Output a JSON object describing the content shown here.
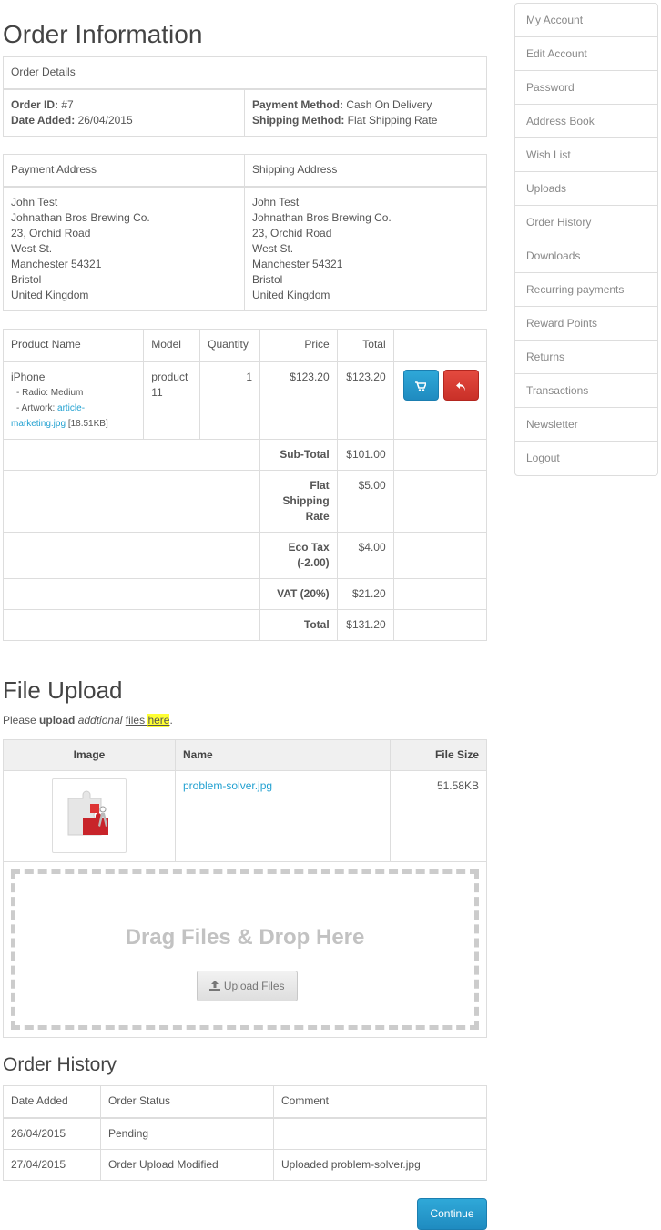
{
  "order_info": {
    "title": "Order Information",
    "details_header": "Order Details",
    "order_id_label": "Order ID:",
    "order_id_value": "#7",
    "date_added_label": "Date Added:",
    "date_added_value": "26/04/2015",
    "payment_method_label": "Payment Method:",
    "payment_method_value": "Cash On Delivery",
    "shipping_method_label": "Shipping Method:",
    "shipping_method_value": "Flat Shipping Rate"
  },
  "addresses": {
    "payment_header": "Payment Address",
    "shipping_header": "Shipping Address",
    "payment_lines": [
      "John Test",
      "Johnathan Bros Brewing Co.",
      "23, Orchid Road",
      "West St.",
      "Manchester 54321",
      "Bristol",
      "United Kingdom"
    ],
    "shipping_lines": [
      "John Test",
      "Johnathan Bros Brewing Co.",
      "23, Orchid Road",
      "West St.",
      "Manchester 54321",
      "Bristol",
      "United Kingdom"
    ]
  },
  "products": {
    "headers": [
      "Product Name",
      "Model",
      "Quantity",
      "Price",
      "Total"
    ],
    "row": {
      "name": "iPhone",
      "option1": "- Radio: Medium",
      "option2_label": "- Artwork:",
      "option2_link_a": "article-",
      "option2_link_b": "marketing.jpg",
      "option2_size": "[18.51KB]",
      "model_a": "product",
      "model_b": "11",
      "quantity": "1",
      "price": "$123.20",
      "total": "$123.20"
    },
    "totals": [
      {
        "label": "Sub-Total",
        "value": "$101.00"
      },
      {
        "label_lines": [
          "Flat",
          "Shipping",
          "Rate"
        ],
        "value": "$5.00"
      },
      {
        "label_lines": [
          "Eco Tax",
          "(-2.00)"
        ],
        "value": "$4.00"
      },
      {
        "label": "VAT (20%)",
        "value": "$21.20"
      },
      {
        "label": "Total",
        "value": "$131.20"
      }
    ]
  },
  "file_upload": {
    "title": "File Upload",
    "intro_please": "Please ",
    "intro_upload": "upload",
    "intro_additional": "addtional",
    "intro_files": "files ",
    "intro_here": "here",
    "intro_end": ".",
    "headers": [
      "Image",
      "Name",
      "File Size"
    ],
    "file_name": "problem-solver.jpg",
    "file_size": "51.58KB",
    "drop_text": "Drag Files & Drop Here",
    "upload_button": "Upload Files"
  },
  "history": {
    "title": "Order History",
    "headers": [
      "Date Added",
      "Order Status",
      "Comment"
    ],
    "rows": [
      {
        "date": "26/04/2015",
        "status": "Pending",
        "comment": ""
      },
      {
        "date": "27/04/2015",
        "status": "Order Upload Modified",
        "comment": "Uploaded problem-solver.jpg"
      }
    ]
  },
  "continue_button": "Continue",
  "sidebar": {
    "items": [
      {
        "label": "My Account"
      },
      {
        "label": "Edit Account"
      },
      {
        "label": "Password"
      },
      {
        "label": "Address Book"
      },
      {
        "label": "Wish List"
      },
      {
        "label": "Uploads"
      },
      {
        "label": "Order History"
      },
      {
        "label": "Downloads"
      },
      {
        "label": "Recurring payments"
      },
      {
        "label": "Reward Points"
      },
      {
        "label": "Returns"
      },
      {
        "label": "Transactions"
      },
      {
        "label": "Newsletter"
      },
      {
        "label": "Logout"
      }
    ]
  },
  "colors": {
    "link": "#23a1d1",
    "primary_button": "#229ac8",
    "danger_button": "#da4f49",
    "highlight": "#ffff33"
  },
  "icons": {
    "reorder": "cart-icon",
    "return": "return-icon",
    "upload": "upload-icon"
  }
}
